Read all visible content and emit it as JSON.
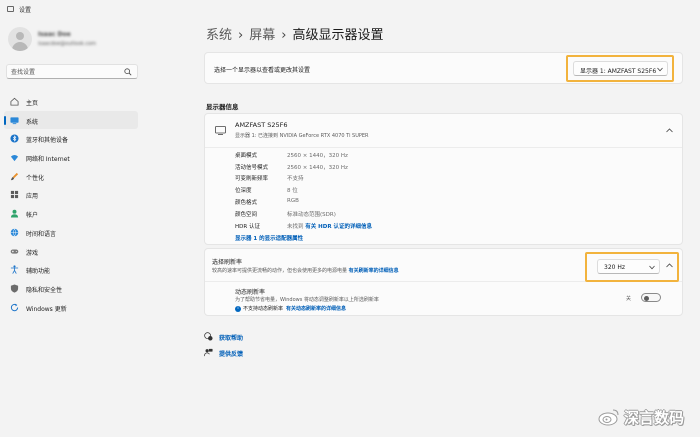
{
  "window": {
    "title": "设置"
  },
  "user": {
    "name": "Isaac Doe",
    "email": "isaacdoe@outlook.com"
  },
  "search": {
    "placeholder": "查找设置"
  },
  "sidebar": {
    "items": [
      {
        "label": "主页",
        "icon": "home-icon"
      },
      {
        "label": "系统",
        "icon": "system-icon",
        "active": true
      },
      {
        "label": "蓝牙和其他设备",
        "icon": "bluetooth-icon"
      },
      {
        "label": "网络和 Internet",
        "icon": "wifi-icon"
      },
      {
        "label": "个性化",
        "icon": "brush-icon"
      },
      {
        "label": "应用",
        "icon": "apps-icon"
      },
      {
        "label": "帐户",
        "icon": "person-icon"
      },
      {
        "label": "时间和语言",
        "icon": "globe-icon"
      },
      {
        "label": "游戏",
        "icon": "gamepad-icon"
      },
      {
        "label": "辅助功能",
        "icon": "accessibility-icon"
      },
      {
        "label": "隐私和安全性",
        "icon": "shield-icon"
      },
      {
        "label": "Windows 更新",
        "icon": "update-icon"
      }
    ]
  },
  "breadcrumb": {
    "items": [
      "系统",
      "屏幕",
      "高级显示器设置"
    ]
  },
  "display_select": {
    "label": "选择一个显示器以查看或更改其设置",
    "selected": "显示器 1: AMZFAST S25F6"
  },
  "display_info": {
    "heading": "显示器信息",
    "name": "AMZFAST S25F6",
    "subtitle": "显示器 1: 已连接到 NVIDIA GeForce RTX 4070 Ti SUPER",
    "rows": [
      {
        "key": "桌面模式",
        "value": "2560 × 1440，320 Hz"
      },
      {
        "key": "活动信号模式",
        "value": "2560 × 1440，320 Hz"
      },
      {
        "key": "可变刷新频率",
        "value": "不支持"
      },
      {
        "key": "位深度",
        "value": "8 位"
      },
      {
        "key": "颜色格式",
        "value": "RGB"
      },
      {
        "key": "颜色空间",
        "value": "标准动态范围(SDR)"
      },
      {
        "key": "HDR 认证",
        "value": "未找到",
        "link": "有关 HDR 认证的详细信息"
      }
    ],
    "adapter_link": "显示器 1 的显示适配器属性"
  },
  "refresh_rate": {
    "title": "选择刷新率",
    "description": "较高的速率可提供更流畅的动作，但也会使用更多的电源电量",
    "link": "有关刷新率的详细信息",
    "selected": "320 Hz"
  },
  "dynamic_refresh": {
    "title": "动态刷新率",
    "description": "为了帮助节省电量，Windows 将动态调整刷新率以上所选刷新率",
    "note": "不支持动态刷新率",
    "note_link": "有关动态刷新率的详细信息",
    "toggle_label": "关",
    "toggle_on": false
  },
  "help": {
    "get_help": "获取帮助",
    "feedback": "提供反馈"
  },
  "watermark": {
    "text": "深言数码"
  },
  "colors": {
    "accent": "#0067c0",
    "link": "#005fb8",
    "highlight": "#f2b33d",
    "background": "#f3f3f3"
  }
}
